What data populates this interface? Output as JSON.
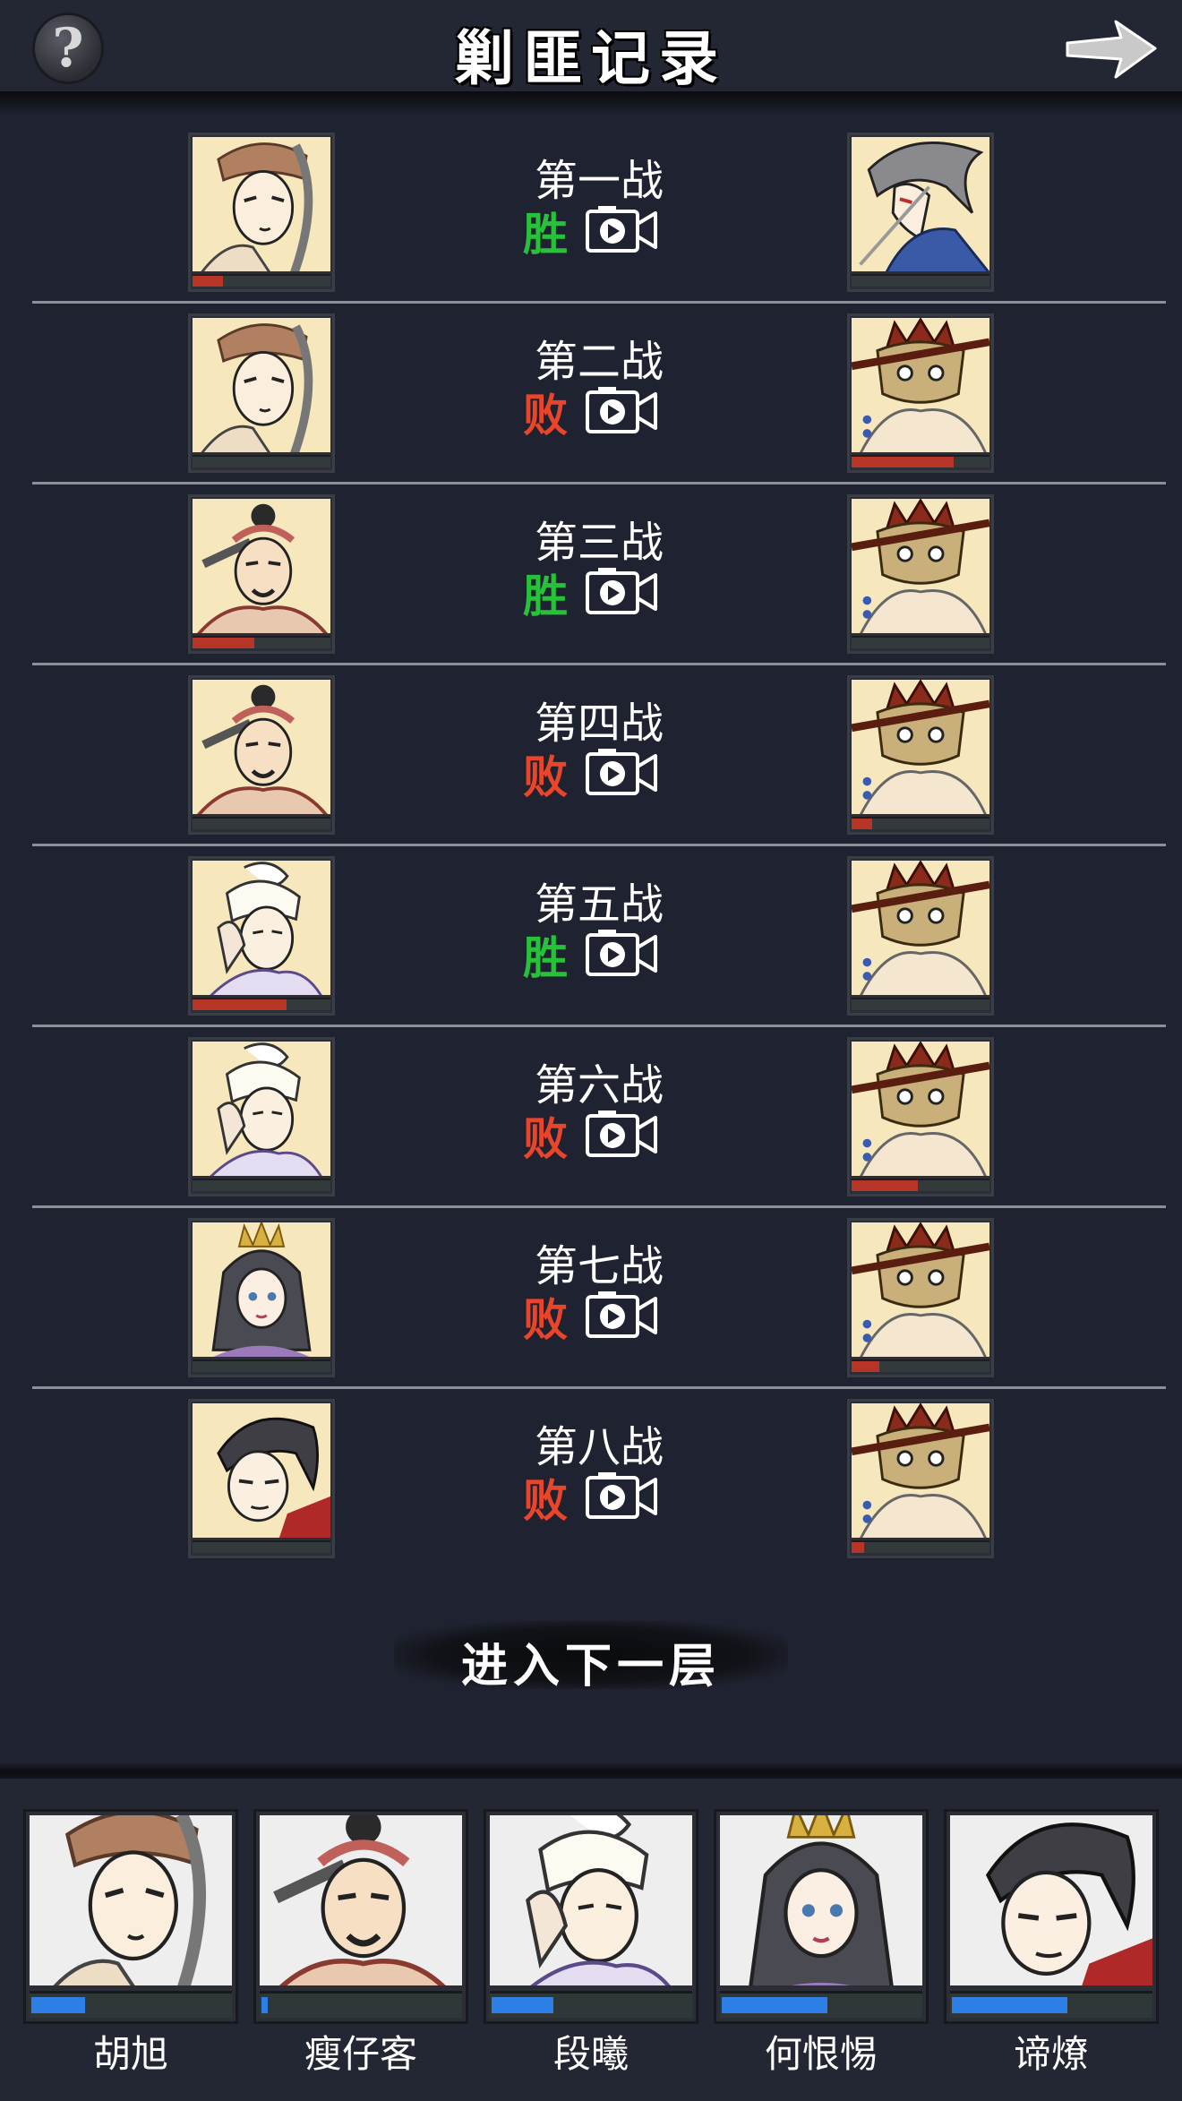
{
  "header": {
    "title": "剿匪记录",
    "help_label": "?"
  },
  "battles": [
    {
      "name": "第一战",
      "result": "胜",
      "outcome": "win",
      "left": {
        "portrait": "hu-xu",
        "hp": 0.22
      },
      "right": {
        "portrait": "grey-hair-swordsman",
        "hp": 0.0
      }
    },
    {
      "name": "第二战",
      "result": "败",
      "outcome": "lose",
      "left": {
        "portrait": "hu-xu",
        "hp": 0.0
      },
      "right": {
        "portrait": "masked-bandit",
        "hp": 0.74
      }
    },
    {
      "name": "第三战",
      "result": "胜",
      "outcome": "win",
      "left": {
        "portrait": "shou-zai-ke",
        "hp": 0.45
      },
      "right": {
        "portrait": "masked-bandit",
        "hp": 0.0
      }
    },
    {
      "name": "第四战",
      "result": "败",
      "outcome": "lose",
      "left": {
        "portrait": "shou-zai-ke",
        "hp": 0.0
      },
      "right": {
        "portrait": "masked-bandit",
        "hp": 0.15
      }
    },
    {
      "name": "第五战",
      "result": "胜",
      "outcome": "win",
      "left": {
        "portrait": "duan-xi",
        "hp": 0.68
      },
      "right": {
        "portrait": "masked-bandit",
        "hp": 0.0
      }
    },
    {
      "name": "第六战",
      "result": "败",
      "outcome": "lose",
      "left": {
        "portrait": "duan-xi",
        "hp": 0.0
      },
      "right": {
        "portrait": "masked-bandit",
        "hp": 0.48
      }
    },
    {
      "name": "第七战",
      "result": "败",
      "outcome": "lose",
      "left": {
        "portrait": "he-hen-yang",
        "hp": 0.0
      },
      "right": {
        "portrait": "masked-bandit",
        "hp": 0.2
      }
    },
    {
      "name": "第八战",
      "result": "败",
      "outcome": "lose",
      "left": {
        "portrait": "di-liao",
        "hp": 0.0
      },
      "right": {
        "portrait": "masked-bandit",
        "hp": 0.09
      }
    }
  ],
  "next_floor_label": "进入下一层",
  "team": [
    {
      "name": "胡旭",
      "portrait": "hu-xu",
      "hp": 0.27
    },
    {
      "name": "瘦仔客",
      "portrait": "shou-zai-ke",
      "hp": 0.03
    },
    {
      "name": "段曦",
      "portrait": "duan-xi",
      "hp": 0.31
    },
    {
      "name": "何恨惕",
      "portrait": "he-hen-yang",
      "hp": 0.53
    },
    {
      "name": "谛燎",
      "portrait": "di-liao",
      "hp": 0.58
    }
  ],
  "colors": {
    "background": "#1f2230",
    "win": "#28c13a",
    "lose": "#e8452a",
    "enemy_hp": "#b73527",
    "team_hp": "#2d7ee5",
    "portrait_bg": "#f7e7bd"
  }
}
